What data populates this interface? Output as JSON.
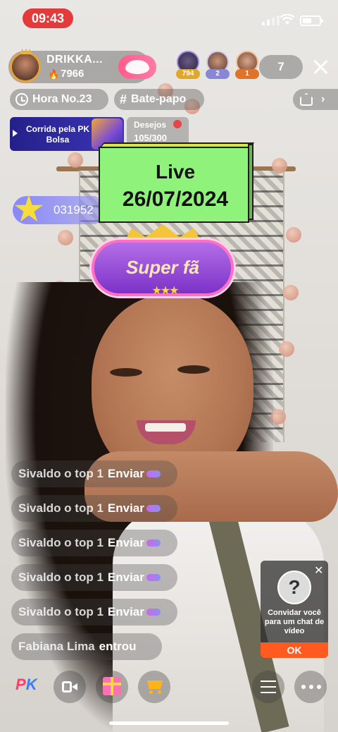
{
  "status_bar": {
    "time": "09:43"
  },
  "host": {
    "name": "DRIKKA...",
    "likes": "7966",
    "flame_icon": "flame-icon"
  },
  "top_viewers": [
    {
      "badge": "794",
      "badge_color": "#e0a72a"
    },
    {
      "badge": "2",
      "badge_color": "#8a86d6"
    },
    {
      "badge": "1",
      "badge_color": "#e0732a"
    }
  ],
  "viewer_count": "7",
  "chips": {
    "hour": "Hora No.23",
    "topic": "Bate-papo",
    "topic_icon": "#"
  },
  "event_banner": {
    "title": "Corrida pela PK Bolsa"
  },
  "wishes": {
    "label": "Desejos",
    "progress": "105/300"
  },
  "live_sign": {
    "line1": "Live",
    "line2": "26/07/2024"
  },
  "viewer_entry": {
    "code": "031952"
  },
  "super_fan": {
    "label": "Super fã"
  },
  "comments": [
    {
      "user": "Sivaldo o top 1",
      "message": "Enviar"
    },
    {
      "user": "Sivaldo o top 1",
      "message": "Enviar"
    },
    {
      "user": "Sivaldo o top 1",
      "message": "Enviar"
    },
    {
      "user": "Sivaldo o top 1",
      "message": "Enviar"
    },
    {
      "user": "Sivaldo o top 1",
      "message": "Enviar"
    },
    {
      "user": "Fabiana Lima",
      "message": "entrou"
    }
  ],
  "invite_card": {
    "question_mark": "?",
    "text": "Convidar você para um chat de vídeo",
    "ok_label": "OK"
  },
  "toolbar": {
    "pk_p": "P",
    "pk_k": "K"
  },
  "colors": {
    "accent_red": "#e33b3b",
    "live_green": "#8ff27a",
    "ok_orange": "#ff5a1f",
    "follow_pink": "#ff5c8d"
  }
}
